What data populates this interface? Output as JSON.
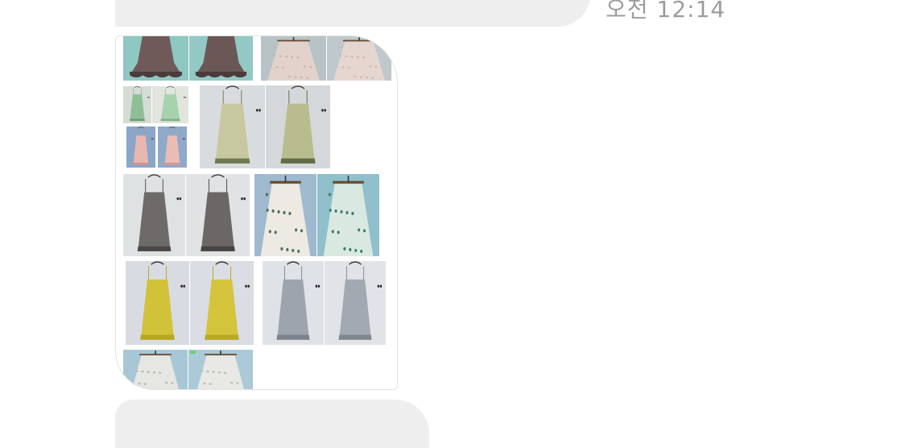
{
  "messages": {
    "timestamp": "오전 12:14",
    "image_message": {
      "photos": [
        {
          "name": "dress-brown-front",
          "item": "dress",
          "bg": "#8fc7c2",
          "color": "#6f5a59",
          "dark": "#4b3b3b"
        },
        {
          "name": "dress-brown-back",
          "item": "dress",
          "bg": "#92c9c4",
          "color": "#6b5756",
          "dark": "#4b3b3b"
        },
        {
          "name": "skirt-beige-front",
          "item": "skirt",
          "bg": "#b8c3c8",
          "color": "#e2d2cb",
          "dark": "#c9b4ad"
        },
        {
          "name": "skirt-beige-back",
          "item": "skirt",
          "bg": "#bfc8cd",
          "color": "#e6d6d0",
          "dark": "#ccb8b2"
        },
        {
          "name": "top-mint-front",
          "item": "cami",
          "bg": "#d5dbd5",
          "color": "#8fbf96",
          "dark": "#6d9c75"
        },
        {
          "name": "top-mint-back",
          "item": "cami",
          "bg": "#e1e5de",
          "color": "#a7d2ae",
          "dark": "#7fae87"
        },
        {
          "name": "top-pink-front",
          "item": "cami",
          "bg": "#8aa6c8",
          "color": "#e9b7b1",
          "dark": "#cf948d"
        },
        {
          "name": "top-pink-back",
          "item": "cami",
          "bg": "#8fa9c9",
          "color": "#ebbcb6",
          "dark": "#d09a93"
        },
        {
          "name": "cami-floral-front",
          "item": "cami",
          "bg": "#d9dcdf",
          "color": "#c8c8a0",
          "dark": "#6e7a52"
        },
        {
          "name": "cami-floral-back",
          "item": "cami",
          "bg": "#d5d8da",
          "color": "#b9bd8e",
          "dark": "#5f6d45"
        },
        {
          "name": "cami-gray-front",
          "item": "cami",
          "bg": "#dfe2e3",
          "color": "#6d6a69",
          "dark": "#4a4747"
        },
        {
          "name": "cami-gray-back",
          "item": "cami",
          "bg": "#e0e2e3",
          "color": "#6b6767",
          "dark": "#474444"
        },
        {
          "name": "skirt-print-front",
          "item": "skirt",
          "bg": "#9fb9cf",
          "color": "#eceae2",
          "dark": "#4f6b5f"
        },
        {
          "name": "skirt-print-back",
          "item": "skirt",
          "bg": "#8fc0cc",
          "color": "#d9e9e1",
          "dark": "#3d7a6a"
        },
        {
          "name": "cami-yellow-front",
          "item": "cami",
          "bg": "#d8dce2",
          "color": "#d1c23a",
          "dark": "#b5a521"
        },
        {
          "name": "cami-yellow-back",
          "item": "cami",
          "bg": "#dadde3",
          "color": "#d4c43c",
          "dark": "#b8a823"
        },
        {
          "name": "cami-bluegray-front",
          "item": "cami",
          "bg": "#dfe2e6",
          "color": "#9ea4ae",
          "dark": "#7d838d"
        },
        {
          "name": "cami-bluegray-back",
          "item": "cami",
          "bg": "#e1e3e7",
          "color": "#a3a9b2",
          "dark": "#7f8690"
        },
        {
          "name": "skirt-white-front",
          "item": "skirt",
          "bg": "#a8c7d6",
          "color": "#e6e6e2",
          "dark": "#b6b7b2"
        },
        {
          "name": "skirt-white-back",
          "item": "skirt",
          "bg": "#acc9d8",
          "color": "#e8e8e4",
          "dark": "#b9bab5"
        }
      ]
    }
  }
}
